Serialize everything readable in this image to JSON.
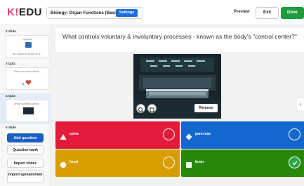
{
  "header": {
    "logo_k": "K!",
    "logo_rest": "EDU",
    "title": "Biology: Organ Functions (Basic)",
    "settings_label": "Settings",
    "preview_label": "Preview",
    "exit_label": "Exit",
    "done_label": "Done"
  },
  "sidebar": {
    "items": [
      {
        "label": "2  Slide",
        "card_title": "Organs",
        "card_sub": "An organ is a part of a..."
      },
      {
        "label": "3  Quiz",
        "card_title": "This is a muscular s...",
        "card_sub": ""
      },
      {
        "label": "4  Quiz",
        "card_title": "What controls volun...",
        "card_sub": ""
      },
      {
        "label": "5  Slide",
        "card_title": "",
        "card_sub": ""
      }
    ],
    "add_question": "Add question",
    "question_bank": "Question bank",
    "import_slides": "Import slides",
    "import_spreadsheet": "Import spreadsheet"
  },
  "main": {
    "question": "What controls voluntary & involuntary processes - known as the body's \"control center?\"",
    "remove_label": "Remove",
    "answers": [
      {
        "text": "spine",
        "shape": "triangle",
        "color": "#e21b3c",
        "correct": false
      },
      {
        "text": "pancreas",
        "shape": "diamond",
        "color": "#1368ce",
        "correct": false
      },
      {
        "text": "heart",
        "shape": "circle",
        "color": "#d89e00",
        "correct": false
      },
      {
        "text": "brain",
        "shape": "square",
        "color": "#26890c",
        "correct": true
      }
    ]
  },
  "icons": {
    "chevron": "chevron-right-icon",
    "zoom": "zoom-icon",
    "crop": "crop-icon",
    "check": "check-icon"
  }
}
